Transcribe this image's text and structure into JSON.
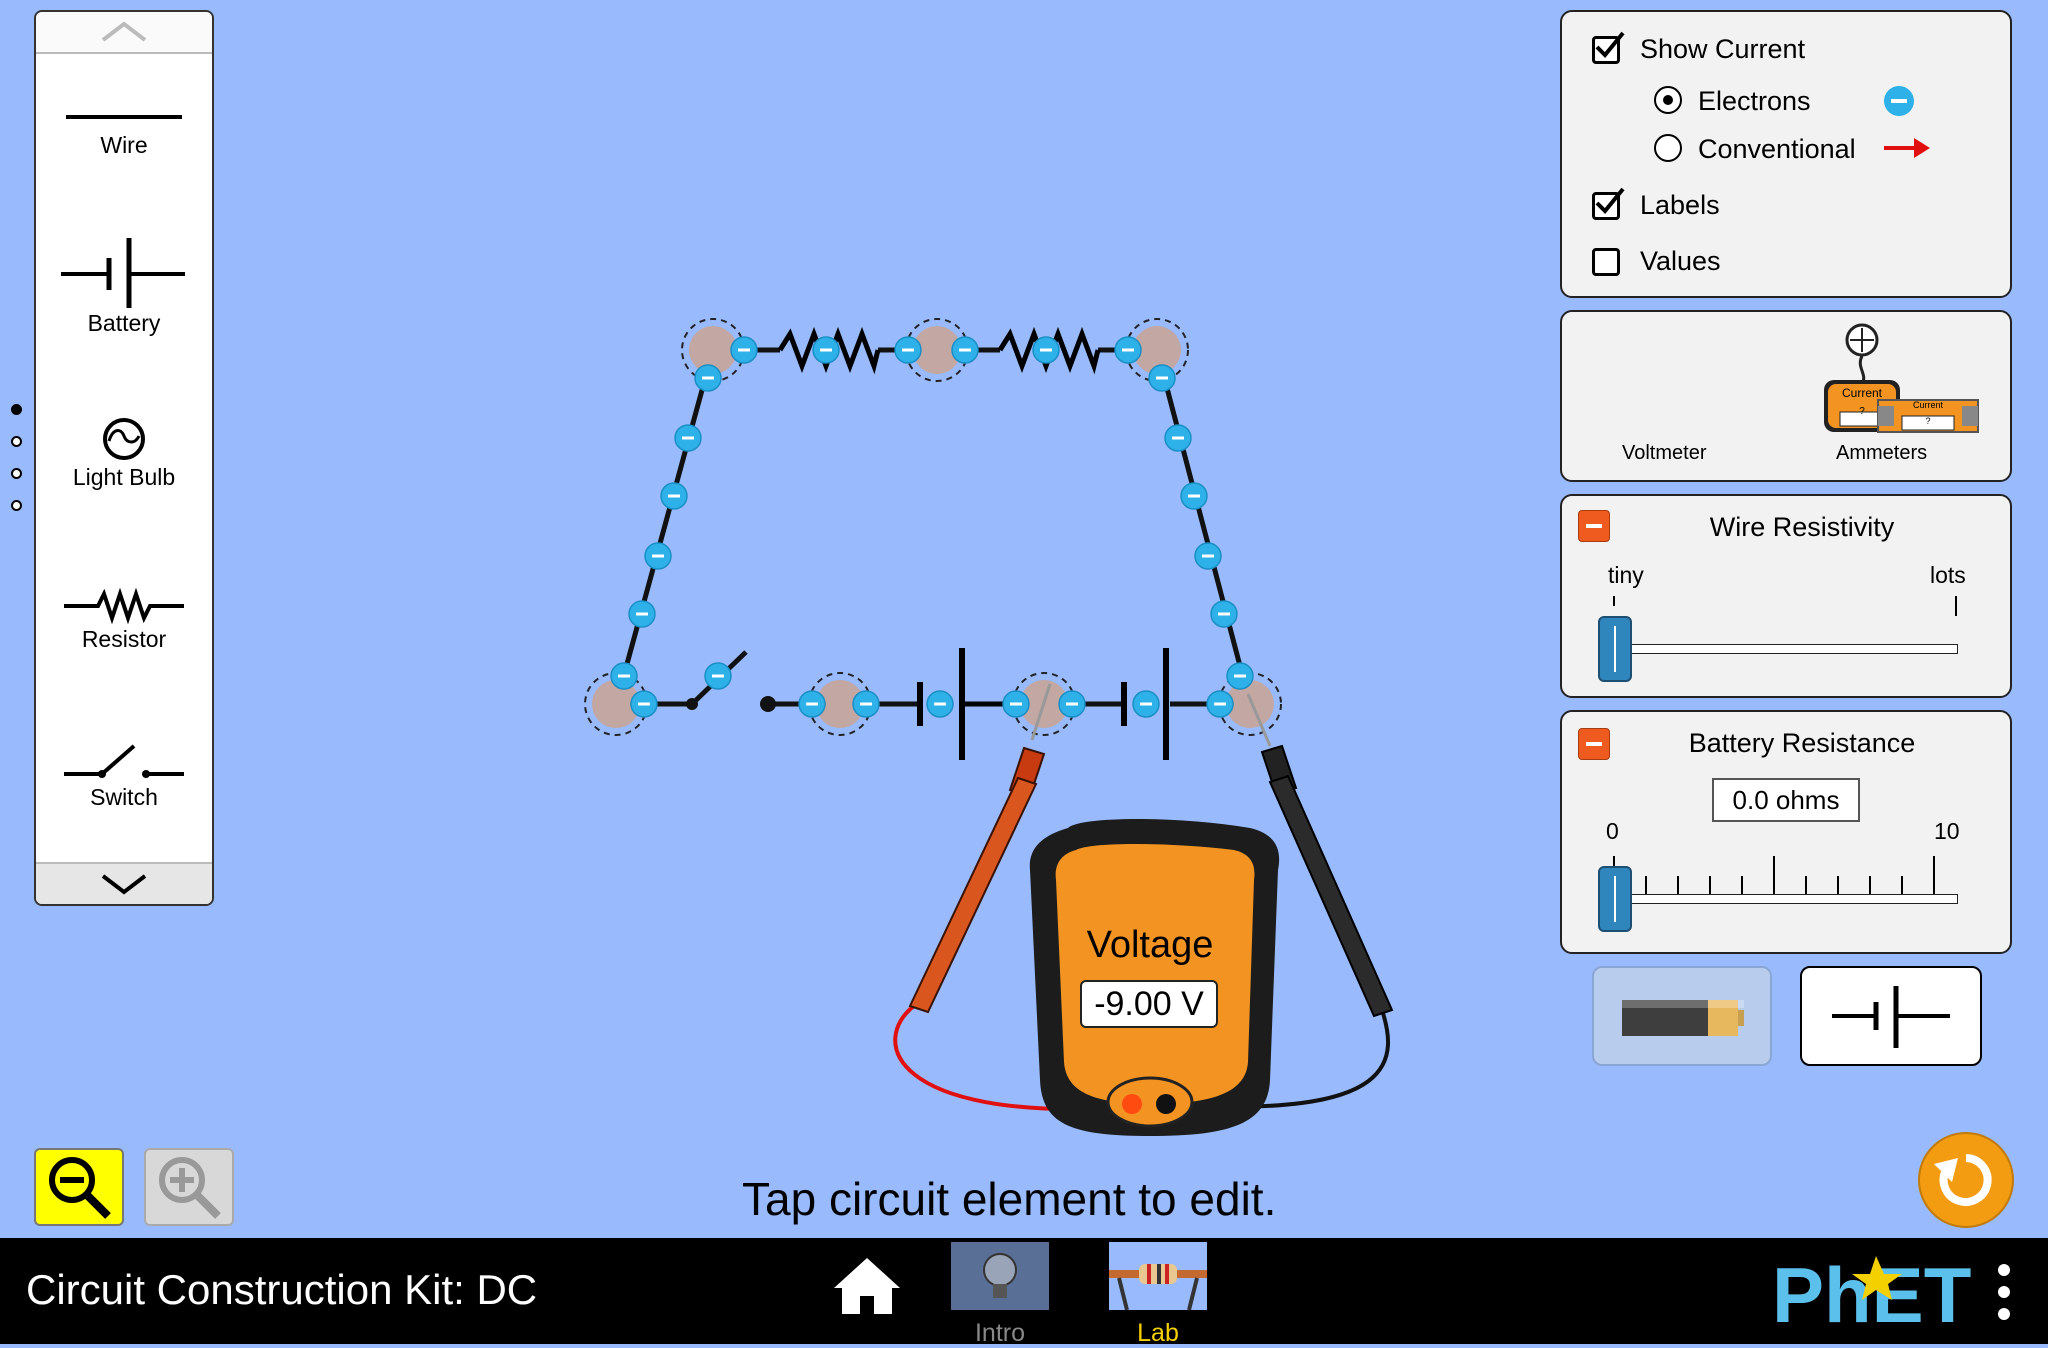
{
  "toolbox": {
    "items": [
      {
        "label": "Wire",
        "icon": "wire-icon"
      },
      {
        "label": "Battery",
        "icon": "battery-icon"
      },
      {
        "label": "Light Bulb",
        "icon": "light-bulb-icon"
      },
      {
        "label": "Resistor",
        "icon": "resistor-icon"
      },
      {
        "label": "Switch",
        "icon": "switch-icon"
      }
    ],
    "page_count": 4,
    "active_page": 1
  },
  "display_panel": {
    "show_current_label": "Show Current",
    "show_current_checked": true,
    "electrons_label": "Electrons",
    "electrons_selected": true,
    "conventional_label": "Conventional",
    "labels_label": "Labels",
    "labels_checked": true,
    "values_label": "Values",
    "values_checked": false
  },
  "sensors_panel": {
    "voltmeter_label": "Voltmeter",
    "ammeters_label": "Ammeters",
    "ammeter_text": "Current",
    "ammeter_value": "?"
  },
  "wire_resistivity": {
    "title": "Wire Resistivity",
    "min_label": "tiny",
    "max_label": "lots",
    "value_fraction": 0
  },
  "battery_resistance": {
    "title": "Battery Resistance",
    "value_text": "0.0 ohms",
    "min_label": "0",
    "max_label": "10",
    "value": 0
  },
  "voltmeter": {
    "title": "Voltage",
    "reading": "-9.00 V"
  },
  "hint": "Tap circuit element to edit.",
  "navbar": {
    "title": "Circuit Construction Kit: DC",
    "screens": [
      {
        "label": "Intro",
        "active": false
      },
      {
        "label": "Lab",
        "active": true
      }
    ],
    "brand": "PhET"
  },
  "colors": {
    "background": "#99bbfe",
    "electron": "#2eb0e8",
    "active_screen": "#f5d000",
    "zoom_active": "#ffff00",
    "reset": "#f39c12"
  }
}
